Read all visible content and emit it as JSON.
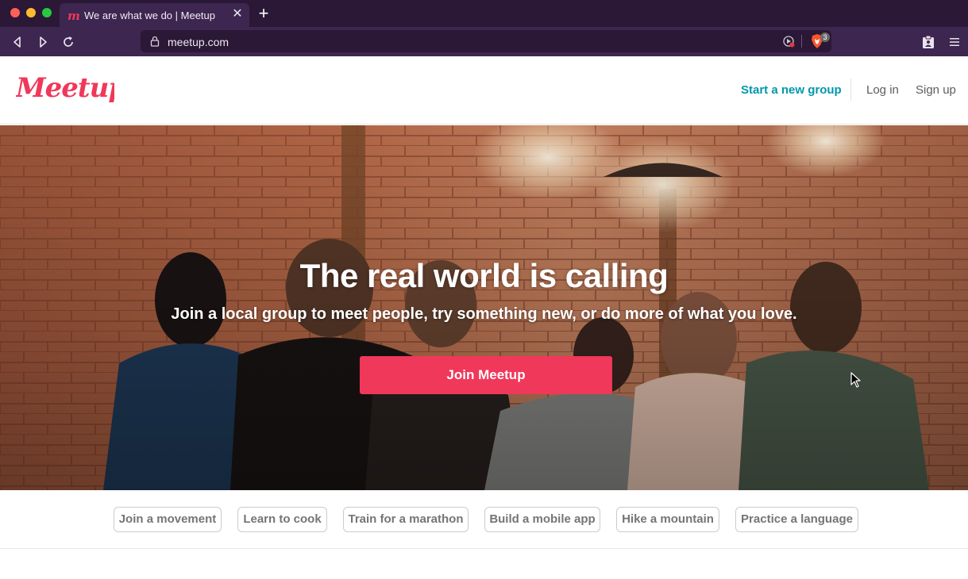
{
  "browser": {
    "tab_title": "We are what we do | Meetup",
    "url": "meetup.com",
    "shield_count": "3",
    "colors": {
      "chrome_dark": "#2b1736",
      "chrome_light": "#3d2650"
    }
  },
  "header": {
    "logo_text": "Meetup",
    "start_group": "Start a new group",
    "log_in": "Log in",
    "sign_up": "Sign up"
  },
  "hero": {
    "title": "The real world is calling",
    "subtitle": "Join a local group to meet people, try something new, or do more of what you love.",
    "cta": "Join Meetup"
  },
  "topics": [
    "Join a movement",
    "Learn to cook",
    "Train for a marathon",
    "Build a mobile app",
    "Hike a mountain",
    "Practice a language"
  ],
  "colors": {
    "brand": "#f0385a",
    "link_teal": "#0098ab"
  },
  "icons": {
    "back": "back-icon",
    "forward": "forward-icon",
    "reload": "reload-icon",
    "lock": "lock-icon",
    "reader": "reader-mode-icon",
    "brave": "brave-shield-icon",
    "wallet": "wallet-icon",
    "menu": "menu-icon"
  }
}
